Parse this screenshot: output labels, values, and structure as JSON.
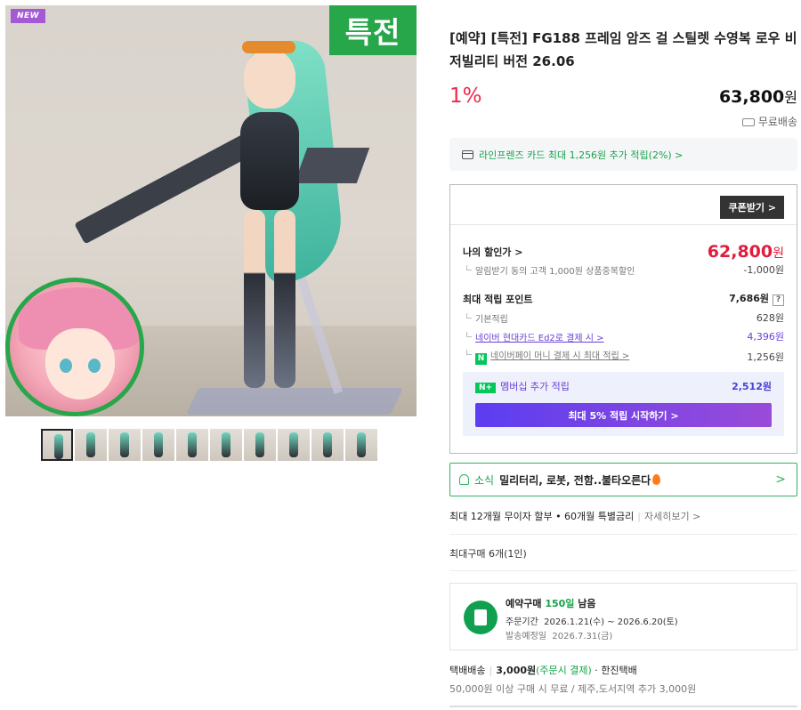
{
  "image": {
    "new_badge": "NEW",
    "special_badge": "특전",
    "thumbnail_count": 10
  },
  "product": {
    "title": "[예약] [특전] FG188 프레임 암즈 걸 스틸렛 수영복 로우 비저빌리티 버전 26.06",
    "discount": "1%",
    "price": "63,800",
    "price_unit": "원",
    "shipping_free": "무료배송"
  },
  "card_promo": "라인프렌즈 카드 최대 1,256원 추가 적립(2%) >",
  "benefit": {
    "coupon_button": "쿠폰받기 >",
    "my_price_label": "나의 할인가 >",
    "my_price": "62,800",
    "my_price_unit": "원",
    "notice_discount_label": "알림받기 동의 고객 1,000원 상품중복할인",
    "notice_discount_value": "-1,000원",
    "max_points_label": "최대 적립 포인트",
    "max_points_value": "7,686원",
    "help": "?",
    "base_label": "기본적립",
    "base_value": "628원",
    "hyundai_label": "네이버 현대카드 Ed2로 결제 시 >",
    "hyundai_value": "4,396원",
    "npay_badge": "N",
    "npay_label": "네이버페이 머니 결제 시 최대 적립 >",
    "npay_value": "1,256원",
    "member_badge": "N+",
    "member_label": "멤버십 추가 적립",
    "member_value": "2,512원",
    "member_cta": "최대 5% 적립 시작하기 >"
  },
  "news": {
    "tag": "소식",
    "message": "밀리터리, 로봇, 전함..불타오른다",
    "chevron": ">"
  },
  "installment": {
    "text": "최대 12개월 무이자 할부 • 60개월 특별금리",
    "more": "자세히보기 >"
  },
  "max_buy": "최대구매 6개(1인)",
  "preorder": {
    "label": "예약구매",
    "days": "150일",
    "remaining": "남음",
    "period_label": "주문기간",
    "period": "2026.1.21(수) ~ 2026.6.20(토)",
    "ship_label": "발송예정일",
    "ship_date": "2026.7.31(금)"
  },
  "shipping": {
    "type": "택배배송",
    "fee": "3,000원",
    "fee_note": "(주문시 결제)",
    "carrier": "한진택배",
    "condition": "50,000원 이상 구매 시 무료 / 제주,도서지역 추가 3,000원"
  },
  "colors": {
    "accent_green": "#27a64a",
    "price_red": "#e01e3c",
    "discount_red": "#f0284a",
    "purple": "#6b3fd6"
  }
}
